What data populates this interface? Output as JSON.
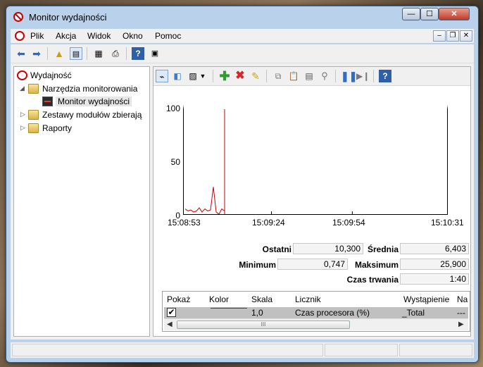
{
  "window": {
    "title": "Monitor wydajności"
  },
  "title_buttons": {
    "minimize": "—",
    "maximize": "☐",
    "close": "✕"
  },
  "menu": {
    "items": [
      "Plik",
      "Akcja",
      "Widok",
      "Okno",
      "Pomoc"
    ]
  },
  "mdi_buttons": {
    "minimize": "–",
    "restore": "❐",
    "close": "✕"
  },
  "tree": {
    "root": "Wydajność",
    "tools": "Narzędzia monitorowania",
    "perfmon": "Monitor wydajności",
    "collector_sets": "Zestawy modułów zbierają",
    "reports": "Raporty"
  },
  "chart_data": {
    "type": "line",
    "y_ticks": [
      "100",
      "50",
      "0"
    ],
    "x_ticks": [
      "15:08:53",
      "15:09:24",
      "15:09:54",
      "15:10:31"
    ],
    "ylim": [
      0,
      100
    ],
    "series": [
      {
        "name": "Czas procesora (%)",
        "color": "#cc0000",
        "x": [
          0,
          1,
          2,
          3,
          4,
          5,
          6,
          7,
          8,
          9,
          10,
          11,
          12,
          13,
          14
        ],
        "values": [
          5,
          3,
          4,
          2,
          3,
          6,
          2,
          5,
          3,
          4,
          26,
          2,
          0,
          5,
          3
        ]
      }
    ],
    "cursor_index": 14
  },
  "stats": {
    "last_label": "Ostatni",
    "last": "10,300",
    "avg_label": "Średnia",
    "avg": "6,403",
    "min_label": "Minimum",
    "min": "0,747",
    "max_label": "Maksimum",
    "max": "25,900",
    "duration_label": "Czas trwania",
    "duration": "1:40"
  },
  "legend": {
    "headers": [
      "Pokaż",
      "Kolor",
      "Skala",
      "Licznik",
      "Wystąpienie",
      "Na"
    ],
    "row": {
      "check": "✔",
      "scale": "1,0",
      "counter": "Czas procesora (%)",
      "instance": "_Total",
      "na": "---"
    },
    "scroll_grip": "III"
  }
}
